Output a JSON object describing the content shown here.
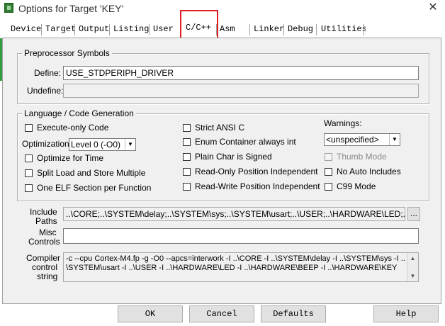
{
  "window": {
    "title": "Options for Target 'KEY'"
  },
  "tabs": [
    "Device",
    "Target",
    "Output",
    "Listing",
    "User",
    "C/C++",
    "Asm",
    "Linker",
    "Debug",
    "Utilities"
  ],
  "active_tab": "C/C++",
  "preprocessor": {
    "group_label": "Preprocessor Symbols",
    "define_label": "Define:",
    "define_value": "USE_STDPERIPH_DRIVER",
    "undefine_label": "Undefine:",
    "undefine_value": ""
  },
  "language": {
    "group_label": "Language / Code Generation",
    "execute_only": "Execute-only Code",
    "optimization_label": "Optimization:",
    "optimization_value": "Level 0 (-O0)",
    "optimize_time": "Optimize for Time",
    "split_load": "Split Load and Store Multiple",
    "one_elf": "One ELF Section per Function",
    "strict_ansi": "Strict ANSI C",
    "enum_container": "Enum Container always int",
    "plain_char": "Plain Char is Signed",
    "ropi": "Read-Only Position Independent",
    "rwpi": "Read-Write Position Independent",
    "warnings_label": "Warnings:",
    "warnings_value": "<unspecified>",
    "thumb_mode": "Thumb Mode",
    "no_auto_includes": "No Auto Includes",
    "c99_mode": "C99 Mode"
  },
  "include_paths": {
    "label_line1": "Include",
    "label_line2": "Paths",
    "value": "..\\CORE;..\\SYSTEM\\delay;..\\SYSTEM\\sys;..\\SYSTEM\\usart;..\\USER;..\\HARDWARE\\LED;..\\HAR",
    "browse": "..."
  },
  "misc_controls": {
    "label_line1": "Misc",
    "label_line2": "Controls",
    "value": ""
  },
  "compiler_string": {
    "label_line1": "Compiler",
    "label_line2": "control",
    "label_line3": "string",
    "line1": "-c --cpu Cortex-M4.fp -g -O0 --apcs=interwork -I ..\\CORE -I ..\\SYSTEM\\delay -I ..\\SYSTEM\\sys -I ..",
    "line2": "\\SYSTEM\\usart -I ..\\USER -I ..\\HARDWARE\\LED -I ..\\HARDWARE\\BEEP -I ..\\HARDWARE\\KEY"
  },
  "buttons": {
    "ok": "OK",
    "cancel": "Cancel",
    "defaults": "Defaults",
    "help": "Help"
  },
  "icons": {
    "app": "keil-target-icon",
    "close": "close-icon",
    "dropdown": "chevron-down-icon",
    "scroll_up": "scroll-up-icon",
    "scroll_down": "scroll-down-icon"
  },
  "colors": {
    "highlight_box": "#e02020",
    "panel": "#f0f0f0"
  }
}
